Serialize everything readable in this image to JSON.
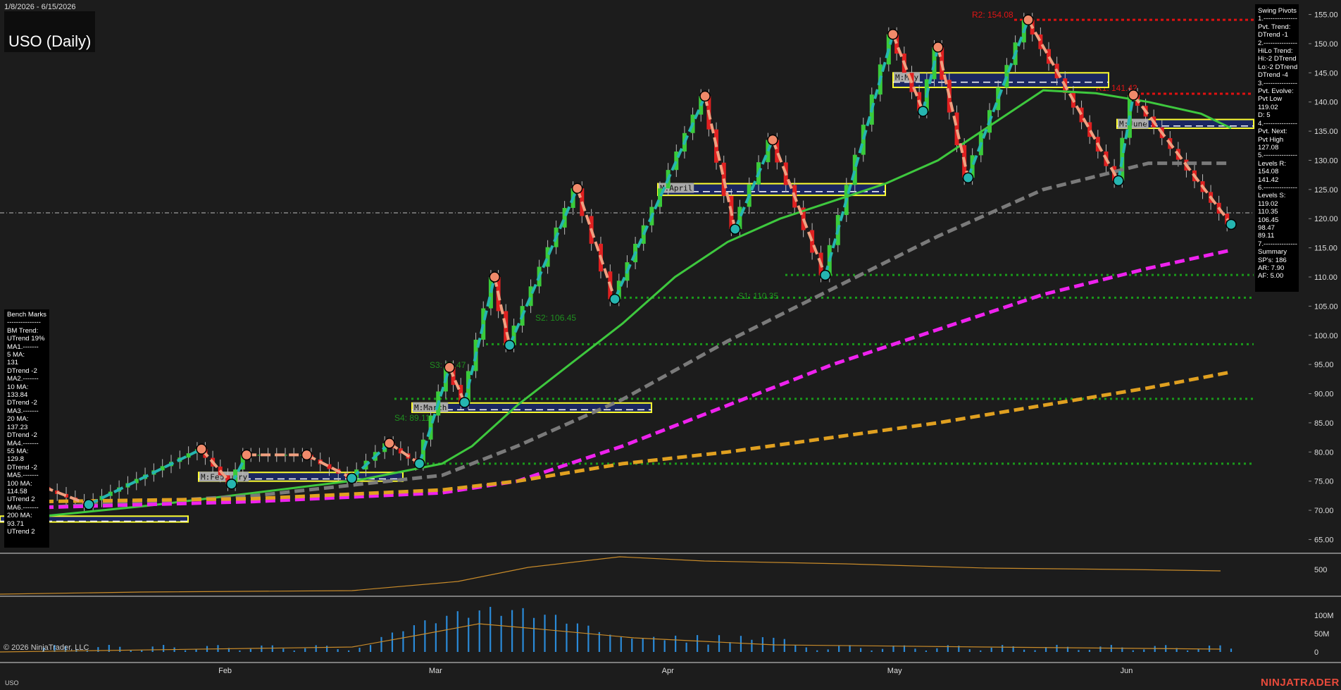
{
  "header": {
    "date_range": "1/8/2026 - 6/15/2026",
    "instrument_title": "USO (Daily)"
  },
  "footer": {
    "copyright": "© 2026 NinjaTrader, LLC",
    "symbol": "USO",
    "brand": "NINJATRADER"
  },
  "swing_pivots_panel": {
    "lines": [
      "Swing Pivots",
      "1.---------------",
      "Pvt. Trend:",
      "DTrend -1",
      "2.---------------",
      "HiLo Trend:",
      "Hi:-2 DTrend",
      "Lo:-2 DTrend",
      "DTrend -4",
      "3.---------------",
      "Pvt. Evolve:",
      "Pvt Low",
      "119.02",
      "D: 5",
      "4.---------------",
      "Pvt. Next:",
      "Pvt High",
      "127.08",
      "5.---------------",
      "Levels R:",
      "154.08",
      "141.42",
      "6.---------------",
      "Levels S:",
      "119.02",
      "110.35",
      "106.45",
      "98.47",
      "89.11",
      "7.---------------",
      "Summary",
      "SP's: 186",
      "AR: 7.90",
      "AF: 5.00"
    ]
  },
  "benchmarks_panel": {
    "lines": [
      "Bench Marks",
      "---------------",
      "BM Trend:",
      "UTrend 19%",
      "MA1.-------",
      "5 MA:",
      "131",
      "DTrend -2",
      "MA2.-------",
      "10 MA:",
      "133.84",
      "DTrend -2",
      "MA3.-------",
      "20 MA:",
      "137.23",
      "DTrend -2",
      "MA4.-------",
      "55 MA:",
      "129.8",
      "DTrend -2",
      "MA5.-------",
      "100 MA:",
      "114.58",
      "UTrend 2",
      "MA6.-------",
      "200 MA:",
      "93.71",
      "UTrend 2"
    ]
  },
  "chart_data": {
    "type": "line",
    "x_month_labels": [
      "Feb",
      "Mar",
      "Apr",
      "May",
      "Jun"
    ],
    "price_axis": {
      "ylim": [
        63,
        157
      ],
      "ticks": [
        65,
        70,
        75,
        80,
        85,
        90,
        95,
        100,
        105,
        110,
        115,
        120,
        125,
        130,
        135,
        140,
        145,
        150,
        155
      ]
    },
    "indicator_axis": {
      "ticks": [
        500
      ]
    },
    "volume_axis": {
      "ticks": [
        "100M",
        "50M",
        "0"
      ]
    },
    "resistance_levels": [
      {
        "label": "R2: 154.08",
        "value": 154.08
      },
      {
        "label": "R1: 141.42",
        "value": 141.42
      }
    ],
    "support_levels": [
      {
        "label": "S1: 110.35",
        "value": 110.35
      },
      {
        "label": "S2: 106.45",
        "value": 106.45
      },
      {
        "label": "S3: 98.47",
        "value": 98.47
      },
      {
        "label": "S4: 89.11",
        "value": 89.11
      },
      {
        "label": "",
        "value": 78.0
      }
    ],
    "reference_line": 121,
    "monthly_boxes": [
      {
        "label": "M:February",
        "low": 75.0,
        "high": 76.5
      },
      {
        "label": "M:March",
        "low": 86.8,
        "high": 88.4
      },
      {
        "label": "M:April",
        "low": 124.0,
        "high": 126.0
      },
      {
        "label": "M:May",
        "low": 142.5,
        "high": 145.0
      },
      {
        "label": "M:June",
        "low": 135.5,
        "high": 137.0
      },
      {
        "label": "",
        "low": 68.0,
        "high": 69.0
      }
    ],
    "swing_pivots": [
      {
        "date": "2026-01-08",
        "price": 74.0,
        "type": "high"
      },
      {
        "date": "2026-01-14",
        "price": 71.0,
        "type": "low"
      },
      {
        "date": "2026-01-29",
        "price": 80.5,
        "type": "high"
      },
      {
        "date": "2026-02-02",
        "price": 74.5,
        "type": "low"
      },
      {
        "date": "2026-02-04",
        "price": 79.5,
        "type": "high"
      },
      {
        "date": "2026-02-12",
        "price": 79.5,
        "type": "high"
      },
      {
        "date": "2026-02-18",
        "price": 75.5,
        "type": "low"
      },
      {
        "date": "2026-02-23",
        "price": 81.5,
        "type": "high"
      },
      {
        "date": "2026-02-27",
        "price": 78.0,
        "type": "low"
      },
      {
        "date": "2026-03-03",
        "price": 94.5,
        "type": "high"
      },
      {
        "date": "2026-03-05",
        "price": 88.5,
        "type": "low"
      },
      {
        "date": "2026-03-09",
        "price": 110.0,
        "type": "high"
      },
      {
        "date": "2026-03-11",
        "price": 98.3,
        "type": "low"
      },
      {
        "date": "2026-03-20",
        "price": 125.2,
        "type": "high"
      },
      {
        "date": "2026-03-25",
        "price": 106.2,
        "type": "low"
      },
      {
        "date": "2026-04-06",
        "price": 141.0,
        "type": "high"
      },
      {
        "date": "2026-04-10",
        "price": 118.2,
        "type": "low"
      },
      {
        "date": "2026-04-15",
        "price": 133.5,
        "type": "high"
      },
      {
        "date": "2026-04-22",
        "price": 110.3,
        "type": "low"
      },
      {
        "date": "2026-05-01",
        "price": 151.6,
        "type": "high"
      },
      {
        "date": "2026-05-05",
        "price": 138.4,
        "type": "low"
      },
      {
        "date": "2026-05-07",
        "price": 149.4,
        "type": "high"
      },
      {
        "date": "2026-05-11",
        "price": 127.0,
        "type": "low"
      },
      {
        "date": "2026-05-19",
        "price": 154.08,
        "type": "high"
      },
      {
        "date": "2026-05-31",
        "price": 126.5,
        "type": "low"
      },
      {
        "date": "2026-06-02",
        "price": 141.2,
        "type": "high"
      },
      {
        "date": "2026-06-15",
        "price": 119.02,
        "type": "low"
      }
    ],
    "series": [
      {
        "color": "#3ec83e",
        "style": "solid",
        "points": [
          [
            "2026-01-08",
            69.0
          ],
          [
            "2026-01-22",
            70.8
          ],
          [
            "2026-02-05",
            73.0
          ],
          [
            "2026-02-19",
            75.2
          ],
          [
            "2026-03-02",
            78.0
          ],
          [
            "2026-03-06",
            81.0
          ],
          [
            "2026-03-12",
            88.0
          ],
          [
            "2026-03-19",
            95.0
          ],
          [
            "2026-03-26",
            102.0
          ],
          [
            "2026-04-02",
            110.0
          ],
          [
            "2026-04-09",
            116.0
          ],
          [
            "2026-04-16",
            120.0
          ],
          [
            "2026-04-23",
            123.0
          ],
          [
            "2026-04-30",
            126.0
          ],
          [
            "2026-05-07",
            130.0
          ],
          [
            "2026-05-14",
            136.0
          ],
          [
            "2026-05-21",
            142.0
          ],
          [
            "2026-05-28",
            141.5
          ],
          [
            "2026-06-04",
            140.0
          ],
          [
            "2026-06-11",
            138.0
          ],
          [
            "2026-06-15",
            135.5
          ]
        ]
      },
      {
        "color": "#7a7a7a",
        "style": "dashed",
        "points": [
          [
            "2026-01-08",
            70.5
          ],
          [
            "2026-02-05",
            72.5
          ],
          [
            "2026-03-02",
            76.0
          ],
          [
            "2026-03-12",
            81.0
          ],
          [
            "2026-03-26",
            89.0
          ],
          [
            "2026-04-09",
            99.0
          ],
          [
            "2026-04-23",
            108.0
          ],
          [
            "2026-05-07",
            117.0
          ],
          [
            "2026-05-21",
            125.0
          ],
          [
            "2026-06-04",
            129.5
          ],
          [
            "2026-06-15",
            129.5
          ]
        ]
      },
      {
        "color": "#ee22ee",
        "style": "dashed",
        "points": [
          [
            "2026-01-08",
            70.5
          ],
          [
            "2026-02-05",
            71.5
          ],
          [
            "2026-03-02",
            73.0
          ],
          [
            "2026-03-12",
            75.0
          ],
          [
            "2026-03-26",
            81.0
          ],
          [
            "2026-04-09",
            88.0
          ],
          [
            "2026-04-23",
            95.0
          ],
          [
            "2026-05-07",
            101.0
          ],
          [
            "2026-05-21",
            107.0
          ],
          [
            "2026-06-04",
            111.5
          ],
          [
            "2026-06-15",
            114.6
          ]
        ]
      },
      {
        "color": "#e0a020",
        "style": "dashed",
        "points": [
          [
            "2026-01-08",
            71.5
          ],
          [
            "2026-02-05",
            72.0
          ],
          [
            "2026-03-02",
            73.5
          ],
          [
            "2026-03-12",
            75.0
          ],
          [
            "2026-03-26",
            78.0
          ],
          [
            "2026-04-09",
            80.0
          ],
          [
            "2026-04-23",
            82.5
          ],
          [
            "2026-05-07",
            85.0
          ],
          [
            "2026-05-21",
            88.0
          ],
          [
            "2026-06-04",
            91.0
          ],
          [
            "2026-06-15",
            93.7
          ]
        ]
      }
    ]
  }
}
